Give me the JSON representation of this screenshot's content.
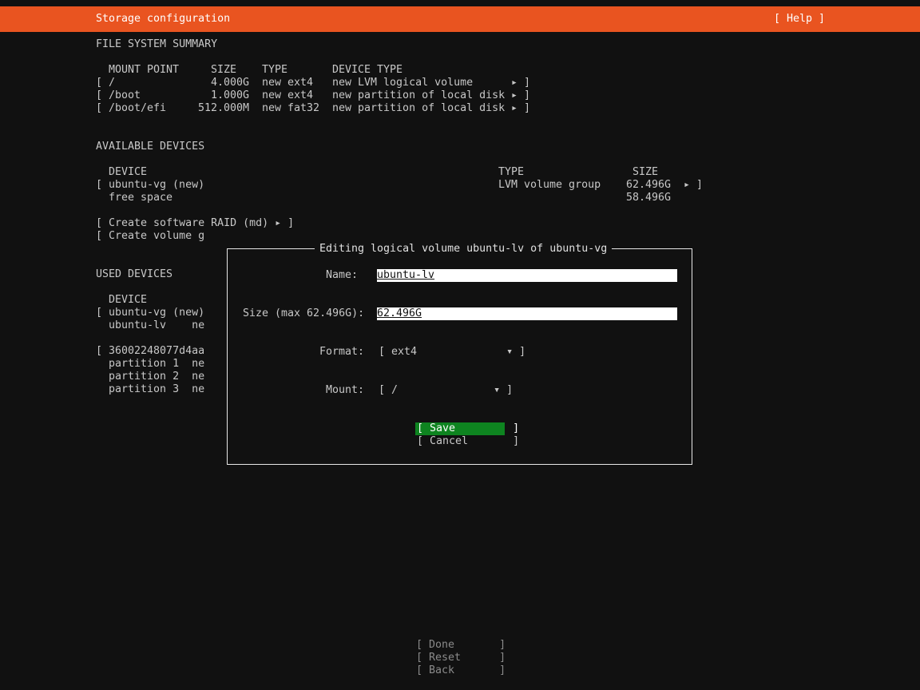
{
  "header": {
    "title": "Storage configuration",
    "help": "[ Help ]"
  },
  "fs_summary": {
    "heading": "FILE SYSTEM SUMMARY",
    "columns": [
      "MOUNT POINT",
      "SIZE",
      "TYPE",
      "DEVICE TYPE"
    ],
    "rows": [
      {
        "bracket": "[",
        "mount": "/",
        "size": "4.000G",
        "type": "new ext4",
        "device_type": "new LVM logical volume",
        "end": "▸ ]"
      },
      {
        "bracket": "[",
        "mount": "/boot",
        "size": "1.000G",
        "type": "new ext4",
        "device_type": "new partition of local disk",
        "end": "▸ ]"
      },
      {
        "bracket": "[",
        "mount": "/boot/efi",
        "size": "512.000M",
        "type": "new fat32",
        "device_type": "new partition of local disk",
        "end": "▸ ]"
      }
    ]
  },
  "available": {
    "heading": "AVAILABLE DEVICES",
    "columns": [
      "DEVICE",
      "TYPE",
      "SIZE"
    ],
    "rows": [
      {
        "bracket": "[",
        "device": "ubuntu-vg (new)",
        "type": "LVM volume group",
        "size": "62.496G",
        "end": "▸ ]"
      },
      {
        "bracket": "",
        "device": "free space",
        "type": "",
        "size": "58.496G",
        "end": ""
      }
    ],
    "actions": [
      "[ Create software RAID (md) ▸ ]",
      "[ Create volume g"
    ]
  },
  "used": {
    "heading": "USED DEVICES",
    "columns": [
      "DEVICE"
    ],
    "lines": [
      "[ ubuntu-vg (new)",
      "  ubuntu-lv    ne",
      "[ 36002248077d4aa",
      "  partition 1  ne",
      "  partition 2  ne",
      "  partition 3  ne"
    ]
  },
  "dialog": {
    "title": "Editing logical volume ubuntu-lv of ubuntu-vg",
    "name_label": "Name:",
    "name_value": "ubuntu-lv",
    "size_label": "Size (max 62.496G):",
    "size_value": "62.496G",
    "format_label": "Format:",
    "format_value": "[ ext4              ▾ ]",
    "mount_label": "Mount:",
    "mount_value": "[ /               ▾ ]",
    "save": "[ Save         ]",
    "cancel": "[ Cancel       ]"
  },
  "footer": {
    "done": "[ Done       ]",
    "reset": "[ Reset      ]",
    "back": "[ Back       ]"
  },
  "colors": {
    "accent": "#e95420",
    "save_bg": "#0e8420",
    "background": "#111111"
  }
}
